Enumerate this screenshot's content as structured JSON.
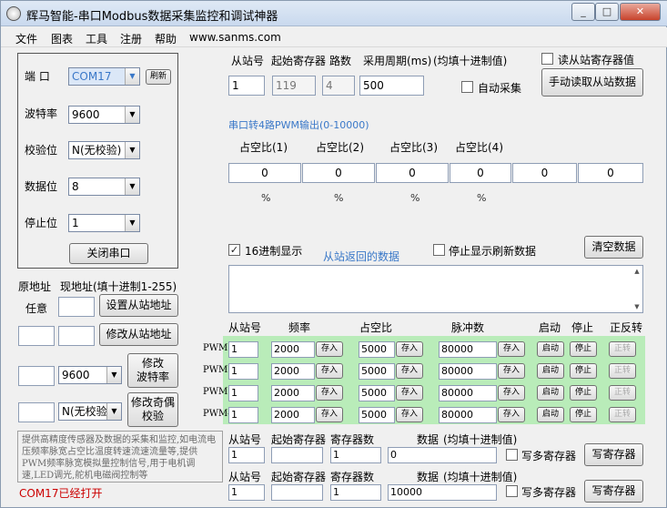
{
  "window": {
    "title": "辉马智能-串口Modbus数据采集监控和调试神器",
    "minimize": "_",
    "maximize": "□",
    "close": "✕"
  },
  "menu": [
    "文件",
    "图表",
    "工具",
    "注册",
    "帮助",
    "www.sanms.com"
  ],
  "serial": {
    "port_label": "端 口",
    "port_value": "COM17",
    "refresh": "刷新",
    "baud_label": "波特率",
    "baud_value": "9600",
    "parity_label": "校验位",
    "parity_value": "N(无校验)",
    "databits_label": "数据位",
    "databits_value": "8",
    "stopbits_label": "停止位",
    "stopbits_value": "1",
    "close_port": "关闭串口"
  },
  "addr": {
    "orig_label": "原地址",
    "new_label": "现地址(填十进制1-255)",
    "any": "任意",
    "set_btn": "设置从站地址",
    "modify_btn": "修改从站地址",
    "baud_value": "9600",
    "modify_baud_btn_l1": "修改",
    "modify_baud_btn_l2": "波特率",
    "parity_value": "N(无校验)",
    "modify_parity_btn_l1": "修改奇偶",
    "modify_parity_btn_l2": "校验"
  },
  "info": {
    "text": "提供高精度传感器及数据的采集和监控,如电流电压频率脉宽占空比温度转速流速流量等,提供PWM频率脉宽模拟量控制信号,用于电机调速,LED调光,舵机电磁阀控制等"
  },
  "status": "COM17已经打开",
  "read": {
    "slave_label": "从站号",
    "start_reg_label": "起始寄存器",
    "count_label": "路数",
    "period_label": "采用周期(ms)",
    "hint": "(均填十进制值)",
    "slave_value": "1",
    "start_reg_value": "119",
    "count_value": "4",
    "period_value": "500",
    "auto_label": "自动采集",
    "read_slave_label": "读从站寄存器值",
    "manual_btn": "手动读取从站数据"
  },
  "pwm_out": {
    "header": "串口转4路PWM输出(0-10000)",
    "labels": [
      "占空比(1)",
      "占空比(2)",
      "占空比(3)",
      "占空比(4)"
    ],
    "values": [
      "0",
      "0",
      "0",
      "0",
      "0",
      "0"
    ],
    "pct": "%"
  },
  "display": {
    "hex_label": "16进制显示",
    "returned_label": "从站返回的数据",
    "stop_refresh_label": "停止显示刷新数据",
    "clear_btn": "清空数据"
  },
  "pwm_table": {
    "headers": [
      "从站号",
      "频率",
      "占空比",
      "脉冲数",
      "启动",
      "停止",
      "正反转"
    ],
    "save": "存入",
    "start": "启动",
    "stop": "停止",
    "rev": "正转",
    "rows": [
      {
        "name": "PWM1",
        "slave": "1",
        "freq": "2000",
        "duty": "5000",
        "pulses": "80000"
      },
      {
        "name": "PWM2",
        "slave": "1",
        "freq": "2000",
        "duty": "5000",
        "pulses": "80000"
      },
      {
        "name": "PWM3",
        "slave": "1",
        "freq": "2000",
        "duty": "5000",
        "pulses": "80000"
      },
      {
        "name": "PWM4",
        "slave": "1",
        "freq": "2000",
        "duty": "5000",
        "pulses": "80000"
      }
    ]
  },
  "write1": {
    "slave_label": "从站号",
    "start_reg_label": "起始寄存器",
    "count_label": "寄存器数",
    "data_label": "数据",
    "hint": "(均填十进制值)",
    "slave_value": "1",
    "start_reg_value": "",
    "count_value": "1",
    "data_value": "0",
    "multi_label": "写多寄存器",
    "write_btn": "写寄存器"
  },
  "write2": {
    "slave_label": "从站号",
    "start_reg_label": "起始寄存器",
    "count_label": "寄存器数",
    "data_label": "数据",
    "hint": "(均填十进制值)",
    "slave_value": "1",
    "start_reg_value": "",
    "count_value": "1",
    "data_value": "10000",
    "multi_label": "写多寄存器",
    "write_btn": "写寄存器"
  }
}
